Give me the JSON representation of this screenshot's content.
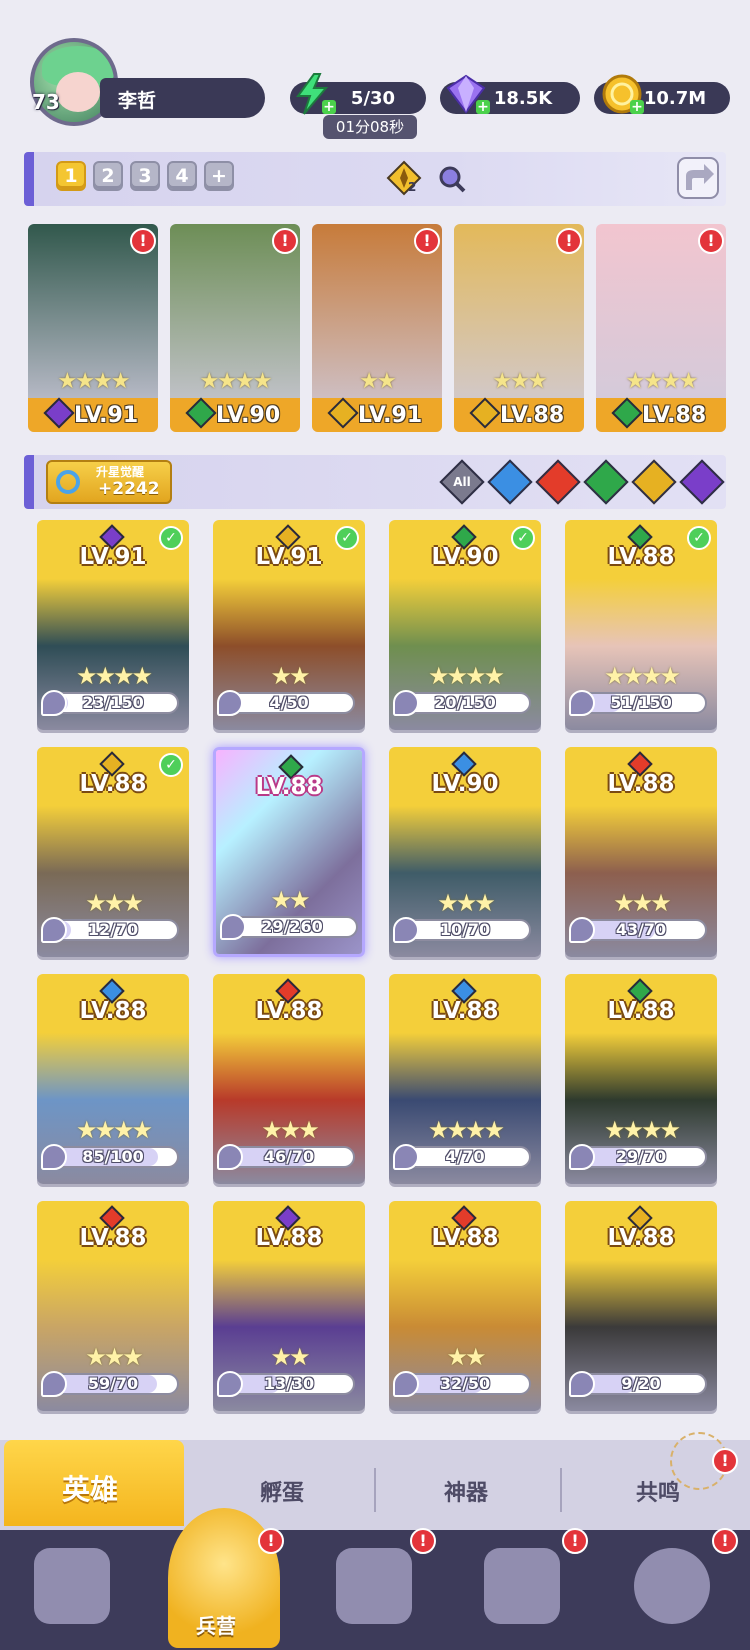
{
  "player": {
    "level": "73",
    "name": "李哲"
  },
  "resources": {
    "energy": "5/30",
    "energy_timer": "01分08秒",
    "gems": "18.5K",
    "gold": "10.7M"
  },
  "teams": {
    "tabs": [
      "1",
      "2",
      "3",
      "4",
      "+"
    ],
    "active": "1",
    "scroll_count": "2"
  },
  "squad": [
    {
      "level": "LV.91",
      "element": "dark",
      "stars": "★★★★",
      "color": "#31584c"
    },
    {
      "level": "LV.90",
      "element": "nature",
      "stars": "★★★★",
      "color": "#6d8e56"
    },
    {
      "level": "LV.91",
      "element": "light",
      "stars": "★★",
      "color": "#c77b3a"
    },
    {
      "level": "LV.88",
      "element": "light",
      "stars": "★★★",
      "color": "#e3b95a"
    },
    {
      "level": "LV.88",
      "element": "nature",
      "stars": "★★★★",
      "color": "#f2c5cf"
    }
  ],
  "awaken": {
    "title": "升星觉醒",
    "value": "+2242"
  },
  "filters": [
    {
      "label": "All",
      "color": "#7b7a8e"
    },
    {
      "label": "",
      "color": "#3b8fe3"
    },
    {
      "label": "",
      "color": "#e33c2a"
    },
    {
      "label": "",
      "color": "#2fa84a"
    },
    {
      "label": "",
      "color": "#e6b122"
    },
    {
      "label": "",
      "color": "#7a3ec9"
    }
  ],
  "heroes": [
    {
      "level": "LV.91",
      "shards": "23/150",
      "fill": 0.15,
      "stars": "★★★★",
      "element_color": "#7a3ec9",
      "checked": true,
      "art": "#2f4d56"
    },
    {
      "level": "LV.91",
      "shards": "4/50",
      "fill": 0.08,
      "stars": "★★",
      "element_color": "#e6b122",
      "checked": true,
      "art": "#8d4e2a"
    },
    {
      "level": "LV.90",
      "shards": "20/150",
      "fill": 0.13,
      "stars": "★★★★",
      "element_color": "#2fa84a",
      "checked": true,
      "art": "#6f8f4f"
    },
    {
      "level": "LV.88",
      "shards": "51/150",
      "fill": 0.34,
      "stars": "★★★★",
      "element_color": "#2fa84a",
      "checked": true,
      "art": "#e7c4b8"
    },
    {
      "level": "LV.88",
      "shards": "12/70",
      "fill": 0.17,
      "stars": "★★★",
      "element_color": "#e6b122",
      "checked": true,
      "art": "#7a6a56"
    },
    {
      "level": "LV.88",
      "shards": "29/260",
      "fill": 0.11,
      "stars": "★★",
      "element_color": "#2fa84a",
      "checked": false,
      "art": "#7d6f9c"
    },
    {
      "level": "LV.90",
      "shards": "10/70",
      "fill": 0.14,
      "stars": "★★★",
      "element_color": "#3b8fe3",
      "checked": false,
      "art": "#3f5c68"
    },
    {
      "level": "LV.88",
      "shards": "43/70",
      "fill": 0.61,
      "stars": "★★★",
      "element_color": "#e33c2a",
      "checked": false,
      "art": "#8d5f4e"
    },
    {
      "level": "LV.88",
      "shards": "85/100",
      "fill": 0.85,
      "stars": "★★★★",
      "element_color": "#3b8fe3",
      "checked": false,
      "art": "#6d95c6"
    },
    {
      "level": "LV.88",
      "shards": "46/70",
      "fill": 0.66,
      "stars": "★★★",
      "element_color": "#e33c2a",
      "checked": false,
      "art": "#b83a2a"
    },
    {
      "level": "LV.88",
      "shards": "4/70",
      "fill": 0.06,
      "stars": "★★★★",
      "element_color": "#3b8fe3",
      "checked": false,
      "art": "#3a4a72"
    },
    {
      "level": "LV.88",
      "shards": "29/70",
      "fill": 0.41,
      "stars": "★★★★",
      "element_color": "#2fa84a",
      "checked": false,
      "art": "#2e3a2e"
    },
    {
      "level": "LV.88",
      "shards": "59/70",
      "fill": 0.84,
      "stars": "★★★",
      "element_color": "#e33c2a",
      "checked": false,
      "art": "#c9a565"
    },
    {
      "level": "LV.88",
      "shards": "13/30",
      "fill": 0.43,
      "stars": "★★",
      "element_color": "#7a3ec9",
      "checked": false,
      "art": "#5a3e92"
    },
    {
      "level": "LV.88",
      "shards": "32/50",
      "fill": 0.64,
      "stars": "★★",
      "element_color": "#e33c2a",
      "checked": false,
      "art": "#c98b35"
    },
    {
      "level": "LV.88",
      "shards": "9/20",
      "fill": 0.45,
      "stars": "",
      "element_color": "#e6b122",
      "checked": false,
      "art": "#3b3a3a"
    }
  ],
  "tabs": {
    "heroes": "英雄",
    "hatch": "孵蛋",
    "artifacts": "神器",
    "resonance": "共鸣"
  },
  "nav": {
    "active_label": "兵营"
  }
}
